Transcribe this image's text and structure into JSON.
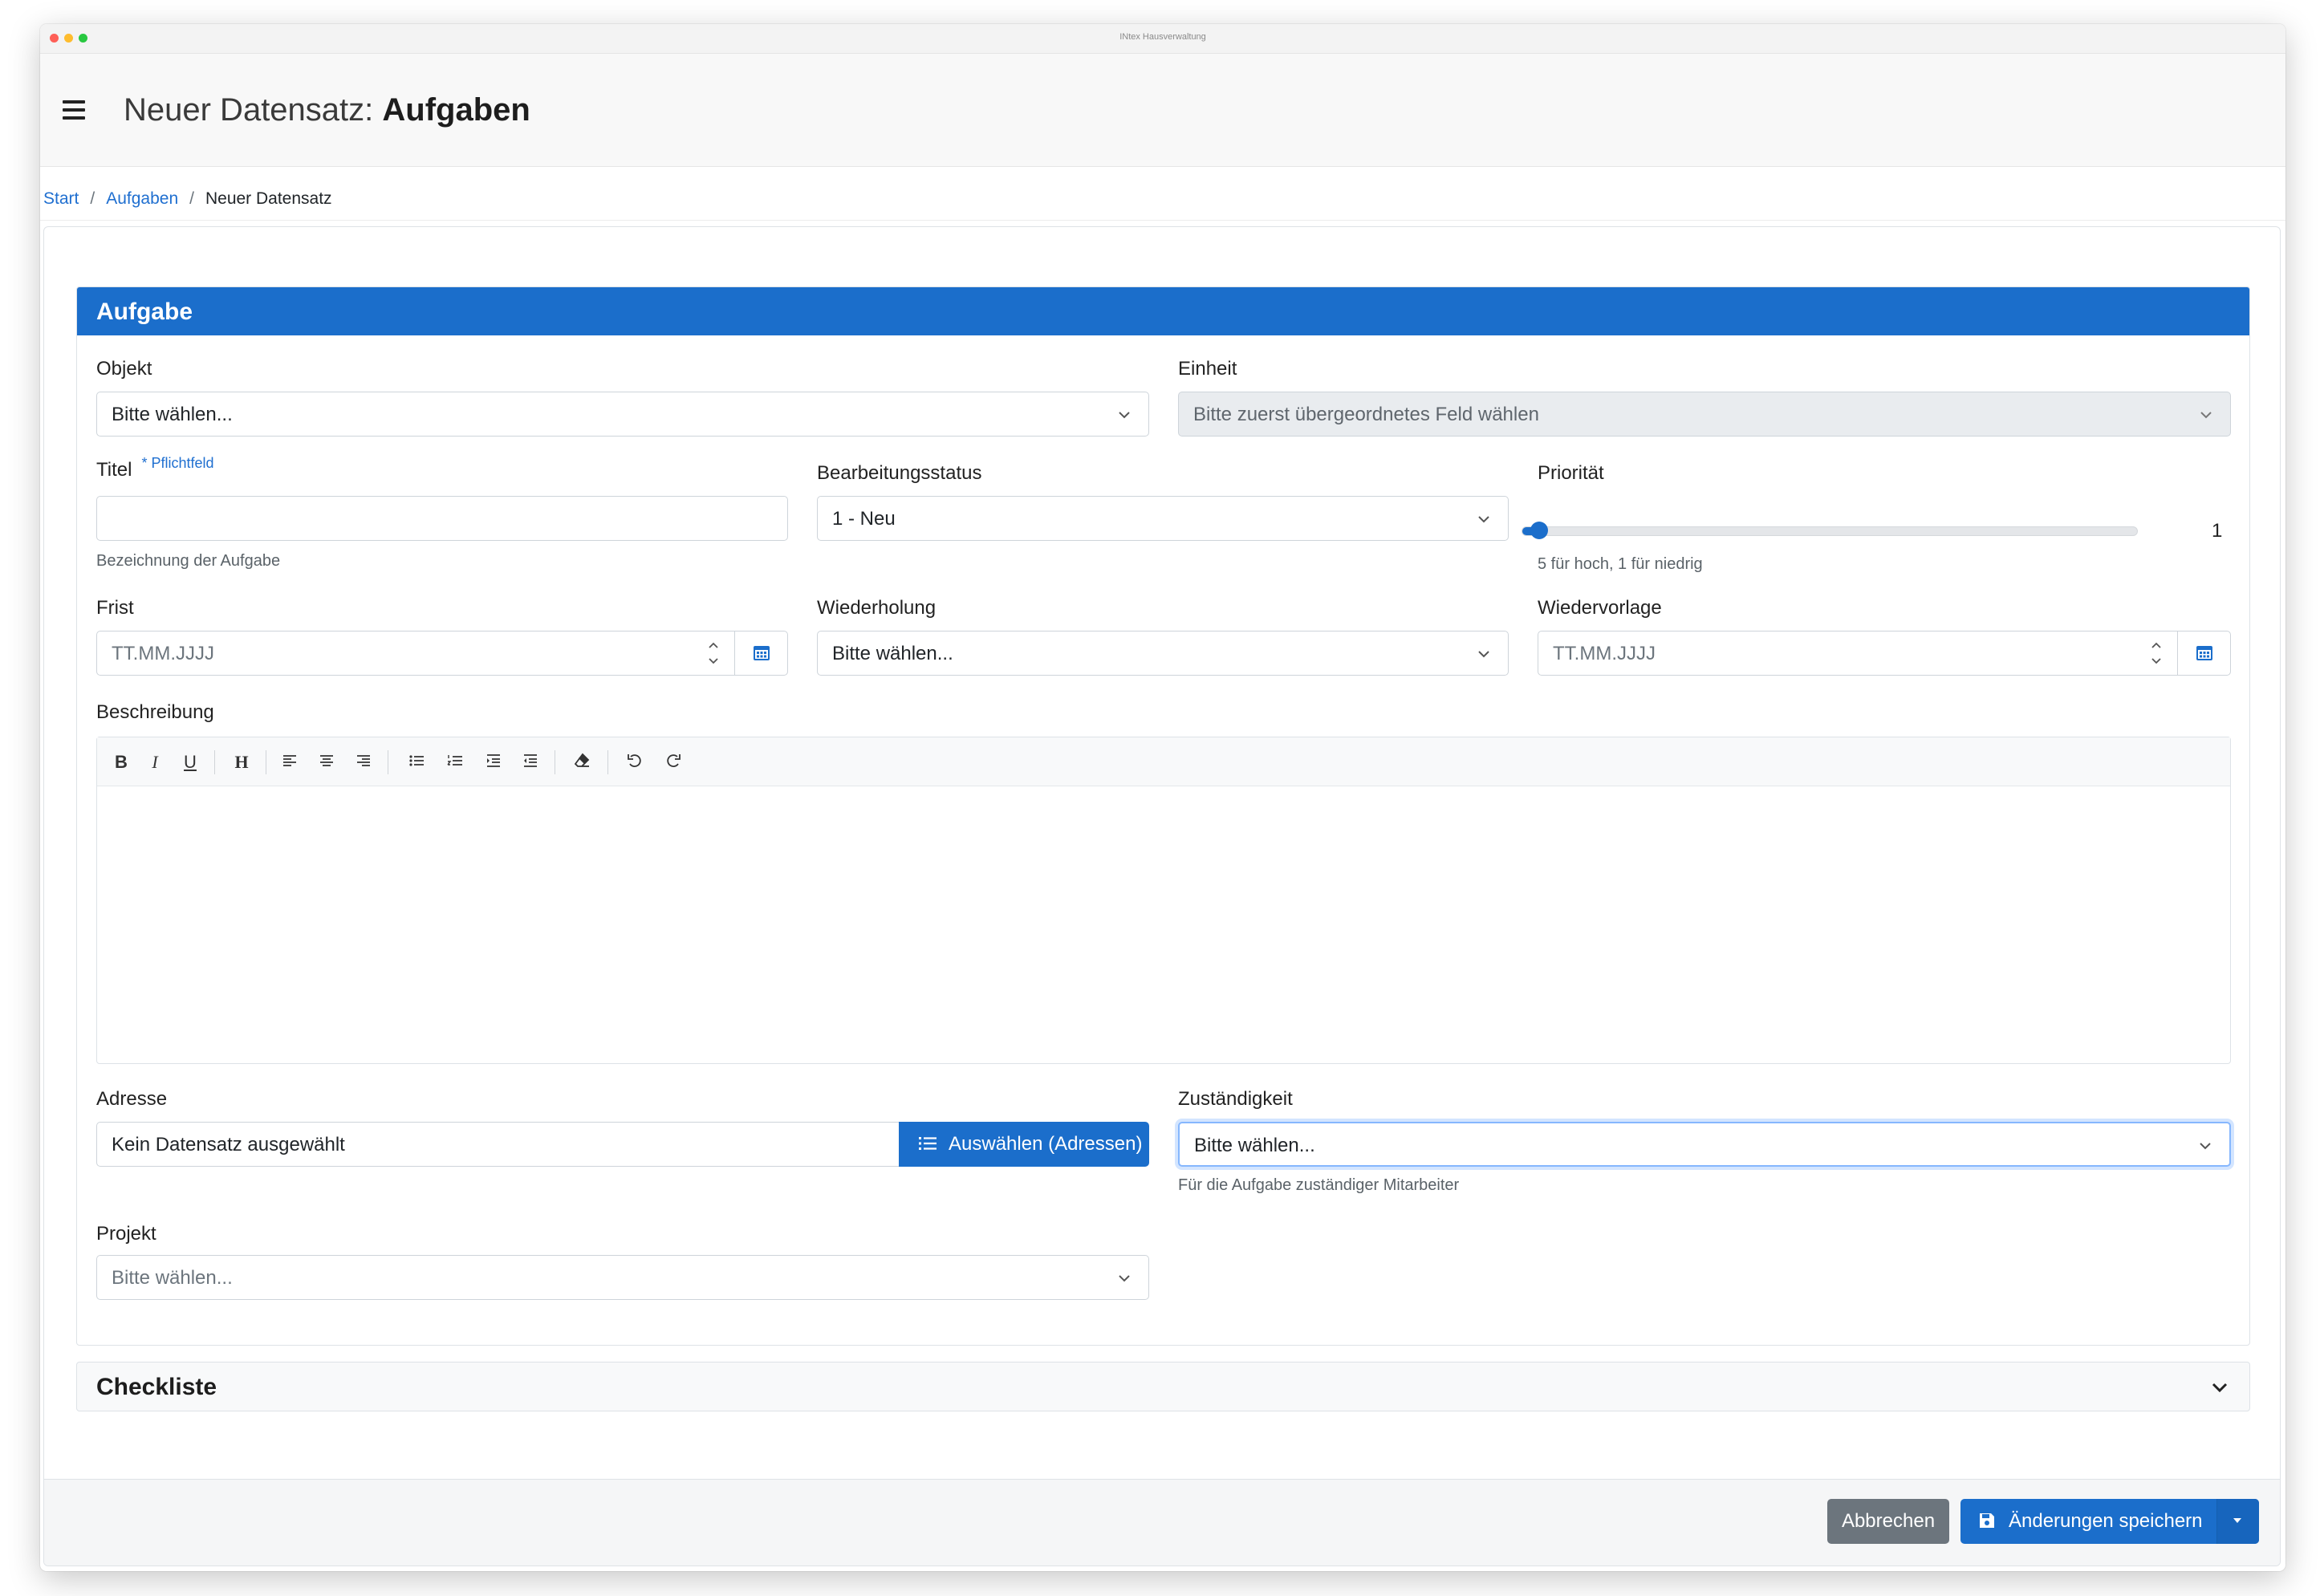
{
  "window": {
    "title": "INtex Hausverwaltung"
  },
  "header": {
    "title_prefix": "Neuer Datensatz:",
    "title_bold": "Aufgaben"
  },
  "breadcrumb": {
    "start": "Start",
    "tasks": "Aufgaben",
    "current": "Neuer Datensatz",
    "separator": "/"
  },
  "section": {
    "title": "Aufgabe",
    "objekt": {
      "label": "Objekt",
      "value": "Bitte wählen..."
    },
    "einheit": {
      "label": "Einheit",
      "value": "Bitte zuerst übergeordnetes Feld wählen"
    },
    "titel": {
      "label": "Titel",
      "required": "* Pflichtfeld",
      "value": "",
      "hint": "Bezeichnung der Aufgabe"
    },
    "status": {
      "label": "Bearbeitungsstatus",
      "value": "1 - Neu"
    },
    "prioritaet": {
      "label": "Priorität",
      "value": "1",
      "min": 1,
      "max": 5,
      "hint": "5 für hoch, 1 für niedrig"
    },
    "frist": {
      "label": "Frist",
      "placeholder": "TT.MM.JJJJ"
    },
    "wiederholung": {
      "label": "Wiederholung",
      "value": "Bitte wählen..."
    },
    "wiedervorlage": {
      "label": "Wiedervorlage",
      "placeholder": "TT.MM.JJJJ"
    },
    "beschreibung": {
      "label": "Beschreibung",
      "toolbar": {
        "bold": "B",
        "italic": "I",
        "underline": "U",
        "heading": "H"
      }
    },
    "adresse": {
      "label": "Adresse",
      "value": "Kein Datensatz ausgewählt",
      "button": "Auswählen (Adressen)"
    },
    "zustaendigkeit": {
      "label": "Zuständigkeit",
      "value": "Bitte wählen...",
      "hint": "Für die Aufgabe zuständiger Mitarbeiter"
    },
    "projekt": {
      "label": "Projekt",
      "placeholder": "Bitte wählen..."
    }
  },
  "checkliste": {
    "title": "Checkliste"
  },
  "footer": {
    "cancel": "Abbrechen",
    "save": "Änderungen speichern"
  },
  "colors": {
    "primary": "#1b6ecb",
    "secondary": "#6c757d",
    "link": "#1f6fd0"
  }
}
